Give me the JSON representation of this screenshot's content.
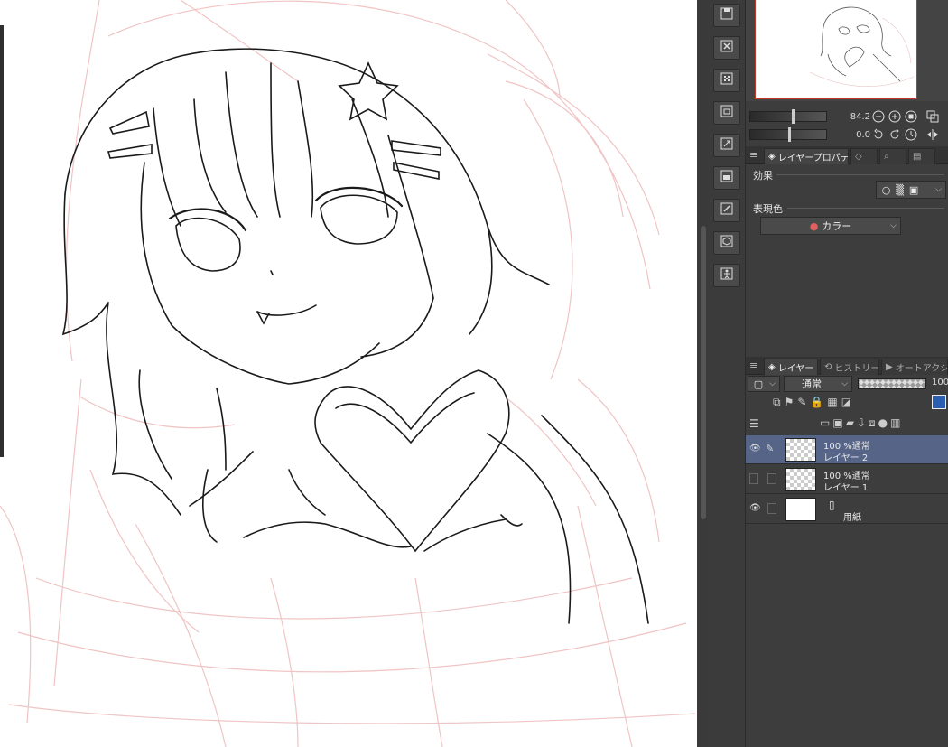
{
  "colors": {
    "panel_bg": "#3d3d3d",
    "selected_layer": "#556487",
    "navigator_border": "#c0392b",
    "sketch_lines": "#f0c4c4",
    "ink": "#1a1a1a"
  },
  "tool_column": {
    "buttons": [
      {
        "name": "save-icon"
      },
      {
        "name": "close-file-icon"
      },
      {
        "name": "tone-icon"
      },
      {
        "name": "export-icon"
      },
      {
        "name": "resize-icon"
      },
      {
        "name": "print-icon"
      },
      {
        "name": "edit-icon"
      },
      {
        "name": "3d-icon"
      },
      {
        "name": "pose-icon"
      }
    ]
  },
  "navigator": {
    "zoom_value": "84.2",
    "rotate_value": "0.0"
  },
  "property_panel": {
    "tabs": [
      "",
      "レイヤープロパティ",
      "",
      ""
    ],
    "effect_label": "効果",
    "expression_color_label": "表現色",
    "expression_color_value": "カラー"
  },
  "layer_panel": {
    "tabs": [
      "レイヤー",
      "ヒストリー",
      "オートアクション"
    ],
    "blend_mode": "通常",
    "opacity": "100",
    "layers": [
      {
        "line1": "100 %通常",
        "line2": "レイヤー 2",
        "visible": true,
        "selected": true,
        "editing": true
      },
      {
        "line1": "100 %通常",
        "line2": "レイヤー 1",
        "visible": false,
        "selected": false,
        "editing": false
      },
      {
        "line1": "",
        "line2": "用紙",
        "visible": true,
        "selected": false,
        "editing": false
      }
    ]
  }
}
